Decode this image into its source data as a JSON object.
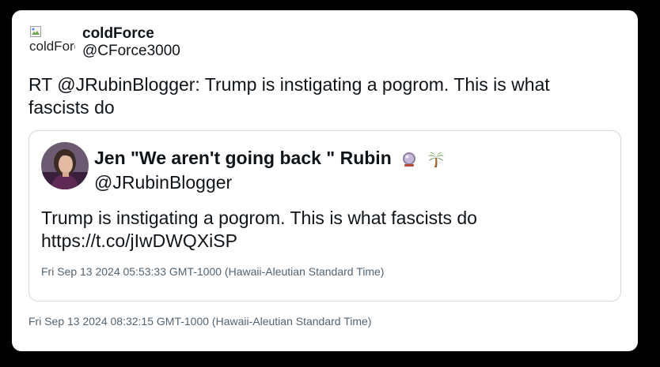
{
  "tweet": {
    "author": {
      "name": "coldForce",
      "handle": "@CForce3000",
      "avatar_alt": "coldForce"
    },
    "text": "RT @JRubinBlogger: Trump is instigating a pogrom. This is what fascists do",
    "timestamp": "Fri Sep 13 2024 08:32:15 GMT-1000 (Hawaii-Aleutian Standard Time)"
  },
  "quoted_tweet": {
    "author": {
      "name": "Jen \"We aren't going back \" Rubin",
      "name_emojis": [
        "crystal-ball-icon",
        "palm-tree-icon"
      ],
      "handle": "@JRubinBlogger"
    },
    "text_line1": "Trump is instigating a pogrom. This is what fascists do",
    "text_line2": "https://t.co/jIwDWQXiSP",
    "timestamp": "Fri Sep 13 2024 05:53:33 GMT-1000 (Hawaii-Aleutian Standard Time)"
  },
  "colors": {
    "background": "#000000",
    "card": "#ffffff",
    "text": "#0f1419",
    "muted": "#536471",
    "border": "#cfd9de"
  }
}
